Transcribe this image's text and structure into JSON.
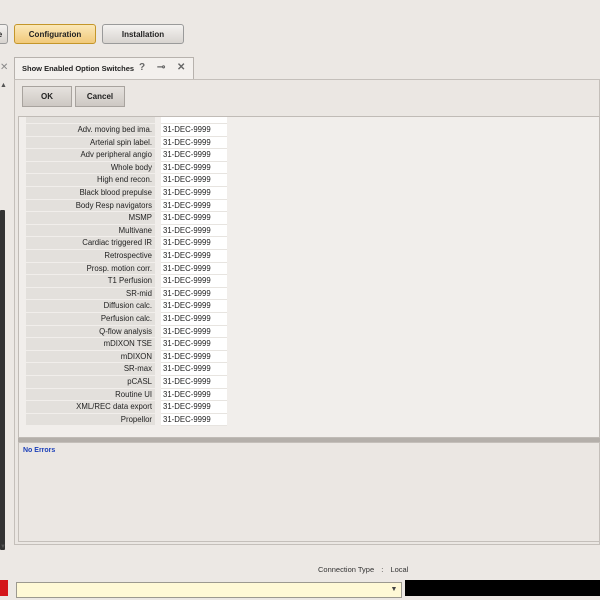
{
  "toolbar": {
    "left_stub_label": "e",
    "configuration_label": "Configuration",
    "installation_label": "Installation"
  },
  "tab": {
    "title": "Show Enabled Option Switches",
    "help_glyph": "?",
    "pin_glyph": "⊸",
    "close_glyph": "✕"
  },
  "actions": {
    "ok_label": "OK",
    "cancel_label": "Cancel"
  },
  "options": [
    {
      "name": "Adv. moving bed ima.",
      "expiry": "31-DEC-9999"
    },
    {
      "name": "Arterial spin label.",
      "expiry": "31-DEC-9999"
    },
    {
      "name": "Adv peripheral angio",
      "expiry": "31-DEC-9999"
    },
    {
      "name": "Whole body",
      "expiry": "31-DEC-9999"
    },
    {
      "name": "High end recon.",
      "expiry": "31-DEC-9999"
    },
    {
      "name": "Black blood prepulse",
      "expiry": "31-DEC-9999"
    },
    {
      "name": "Body Resp navigators",
      "expiry": "31-DEC-9999"
    },
    {
      "name": "MSMP",
      "expiry": "31-DEC-9999"
    },
    {
      "name": "Multivane",
      "expiry": "31-DEC-9999"
    },
    {
      "name": "Cardiac triggered IR",
      "expiry": "31-DEC-9999"
    },
    {
      "name": "Retrospective",
      "expiry": "31-DEC-9999"
    },
    {
      "name": "Prosp. motion corr.",
      "expiry": "31-DEC-9999"
    },
    {
      "name": "T1 Perfusion",
      "expiry": "31-DEC-9999"
    },
    {
      "name": "SR-mid",
      "expiry": "31-DEC-9999"
    },
    {
      "name": "Diffusion calc.",
      "expiry": "31-DEC-9999"
    },
    {
      "name": "Perfusion calc.",
      "expiry": "31-DEC-9999"
    },
    {
      "name": "Q-flow analysis",
      "expiry": "31-DEC-9999"
    },
    {
      "name": "mDIXON TSE",
      "expiry": "31-DEC-9999"
    },
    {
      "name": "mDIXON",
      "expiry": "31-DEC-9999"
    },
    {
      "name": "SR-max",
      "expiry": "31-DEC-9999"
    },
    {
      "name": "pCASL",
      "expiry": "31-DEC-9999"
    },
    {
      "name": "Routine UI",
      "expiry": "31-DEC-9999"
    },
    {
      "name": "XML/REC data export",
      "expiry": "31-DEC-9999"
    },
    {
      "name": "Propellor",
      "expiry": "31-DEC-9999"
    }
  ],
  "messages": {
    "status": "No Errors"
  },
  "status_bar": {
    "connection_label": "Connection Type",
    "separator": ":",
    "connection_value": "Local",
    "combo_value": ""
  },
  "colors": {
    "active_tab_accent": "#f1c97a",
    "error_text": "#1a3eb8",
    "alert_block": "#d4161a"
  }
}
